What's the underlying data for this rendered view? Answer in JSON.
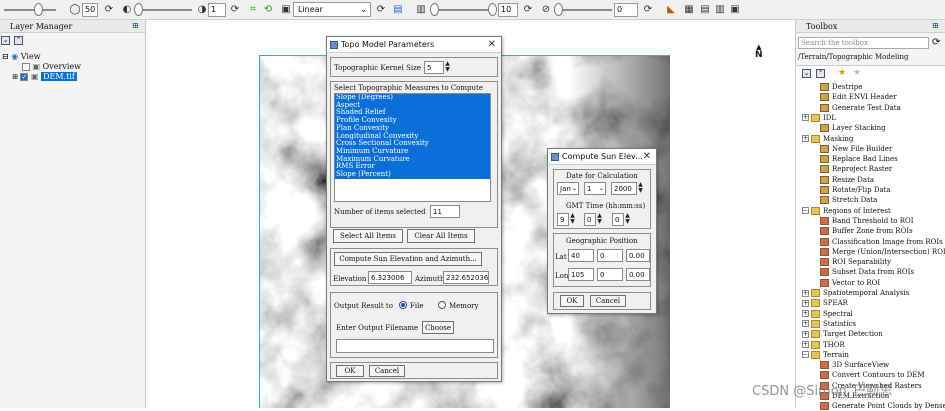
{
  "toolbar": {
    "brightness_value": "50",
    "stretch_value": "1",
    "stretch_type": "Linear",
    "sharpen_value": "10",
    "transparency_value": "0"
  },
  "layer_manager": {
    "title": "Layer Manager",
    "tree": {
      "view": "View",
      "overview": "Overview",
      "layer": "DEM.tif"
    }
  },
  "map": {
    "north_label": "N"
  },
  "toolbox": {
    "title": "Toolbox",
    "search_placeholder": "Search the toolbox",
    "path": "/Terrain/Topographic Modeling",
    "items": [
      "Destripe",
      "Edit ENVI Header",
      "Generate Test Data",
      "IDL",
      "Layer Stacking",
      "Masking",
      "New File Builder",
      "Replace Bad Lines",
      "Reproject Raster",
      "Resize Data",
      "Rotate/Flip Data",
      "Stretch Data",
      "Regions of Interest",
      "Band Threshold to ROI",
      "Buffer Zone from ROIs",
      "Classification Image from ROIs",
      "Merge (Union/Intersection) ROIs",
      "ROI Separability",
      "Subset Data from ROIs",
      "Vector to ROI",
      "Spatiotemporal Analysis",
      "SPEAR",
      "Spectral",
      "Statistics",
      "Target Detection",
      "THOR",
      "Terrain",
      "3D SurfaceView",
      "Convert Contours to DEM",
      "Create Viewshed Rasters",
      "DEM Extraction",
      "Generate Point Clouds by Dense..."
    ]
  },
  "topo_dialog": {
    "title": "Topo Model Parameters",
    "kernel_label": "Topographic Kernel Size",
    "kernel_value": "5",
    "measures_label": "Select Topographic Measures to Compute",
    "measures": [
      "Slope (Degrees)",
      "Aspect",
      "Shaded Relief",
      "Profile Convexity",
      "Plan Convexity",
      "Longitudinal Convexity",
      "Cross Sectional Convexity",
      "Minimum Curvature",
      "Maximum Curvature",
      "RMS Error",
      "Slope (Percent)"
    ],
    "items_selected_label": "Number of items selected",
    "items_selected_value": "11",
    "select_all": "Select All Items",
    "clear_all": "Clear All Items",
    "compute_sun": "Compute Sun Elevation and Azimuth...",
    "elevation_label": "Elevation",
    "elevation_value": "6.323006",
    "azimuth_label": "Azimuth",
    "azimuth_value": "232.652036",
    "output_label": "Output Result to",
    "output_file": "File",
    "output_memory": "Memory",
    "filename_label": "Enter Output Filename",
    "choose": "Choose",
    "filename_value": "",
    "ok": "OK",
    "cancel": "Cancel"
  },
  "sun_dialog": {
    "title": "Compute Sun Elev...",
    "date_label": "Date for Calculation",
    "month": "Jan",
    "day": "1",
    "year": "2000",
    "gmt_label": "GMT Time (hh:mm:ss)",
    "hh": "9",
    "mm": "0",
    "ss": "0",
    "geo_label": "Geographic Position",
    "lat_label": "Lat",
    "lat_deg": "40",
    "lat_min": "0",
    "lat_sec": "0.00",
    "lon_label": "Lon",
    "lon_deg": "105",
    "lon_min": "0",
    "lon_sec": "0.00",
    "ok": "OK",
    "cancel": "Cancel"
  },
  "watermark": "CSDN @Simon_巴勒思"
}
